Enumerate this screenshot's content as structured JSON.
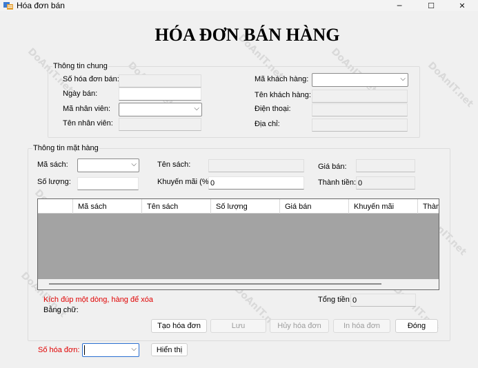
{
  "window": {
    "title": "Hóa đơn bán",
    "minimize": "─",
    "maximize": "☐",
    "close": "✕"
  },
  "watermark": "DoAnIT.net",
  "heading": "HÓA ĐƠN BÁN HÀNG",
  "general": {
    "legend": "Thông tin chung",
    "invoice_no_label": "Số hóa đơn bán:",
    "sale_date_label": "Ngày bán:",
    "employee_id_label": "Mã nhân viên:",
    "employee_name_label": "Tên nhân viên:",
    "customer_id_label": "Mã khách hàng:",
    "customer_name_label": "Tên khách hàng:",
    "phone_label": "Điện thoại:",
    "address_label": "Địa chỉ:"
  },
  "items": {
    "legend": "Thông tin mặt hàng",
    "book_id_label": "Mã sách:",
    "book_name_label": "Tên sách:",
    "price_label": "Giá bán:",
    "qty_label": "Số lượng:",
    "discount_label": "Khuyến mãi (%):",
    "discount_value": "0",
    "subtotal_label": "Thành tiền:",
    "subtotal_value": "0"
  },
  "grid": {
    "columns": [
      "Mã sách",
      "Tên sách",
      "Số lượng",
      "Giá bán",
      "Khuyến mãi",
      "Thành tiền"
    ]
  },
  "footer": {
    "hint": "Kích đúp một dòng, hàng để xóa",
    "in_words_label": "Bằng chữ:",
    "total_label": "Tổng tiền:",
    "total_value": "0"
  },
  "buttons": {
    "create": "Tạo hóa đơn",
    "save": "Lưu",
    "cancel": "Hủy hóa đơn",
    "print": "In hóa đơn",
    "close": "Đóng",
    "show": "Hiển thị"
  },
  "search": {
    "invoice_label": "Số hóa đơn:"
  },
  "colors": {
    "accent_red": "#e00000",
    "grid_body": "#a3a3a3",
    "focus_blue": "#2a6fd1"
  }
}
